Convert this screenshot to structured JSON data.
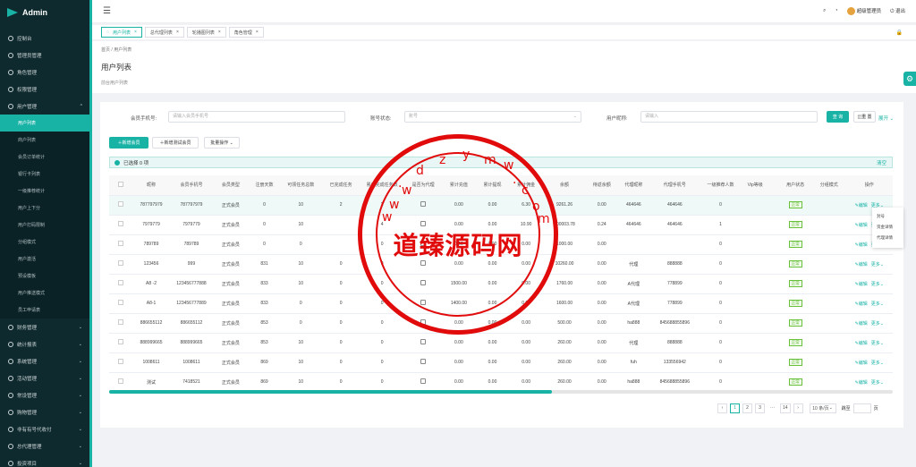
{
  "app": {
    "title": "Admin"
  },
  "sidebar": {
    "items": [
      {
        "label": "控制台"
      },
      {
        "label": "管理员管理"
      },
      {
        "label": "角色管理"
      },
      {
        "label": "权限管理"
      },
      {
        "label": "用户管理",
        "expanded": true
      }
    ],
    "subitems": [
      "用户列表",
      "商户列表",
      "会员订单统计",
      "银行卡列表",
      "一级推荐统计",
      "用户上下分",
      "用户打码限制",
      "分组模式",
      "用户激活",
      "预设模板",
      "用户推送模式",
      "员工申请表"
    ],
    "after": [
      "财务管理",
      "统计报表",
      "系统管理",
      "活动管理",
      "常设管理",
      "购物管理",
      "非有有号代收付",
      "总代理管理",
      "投资项目"
    ]
  },
  "topbar": {
    "admin": "超级管理员",
    "logout": "退出"
  },
  "tabs": [
    "用户列表",
    "总代理列表",
    "轮播图列表",
    "角色管理"
  ],
  "breadcrumb": {
    "home": "首页",
    "sep": "/",
    "current": "用户列表"
  },
  "page": {
    "title": "用户列表",
    "subtitle": "前台用户列表"
  },
  "search": {
    "phone_label": "会员手机号:",
    "phone_placeholder": "请输入会员手机号",
    "status_label": "账号状态:",
    "status_placeholder": "账号",
    "nick_label": "用户昵称:",
    "nick_placeholder": "请输入",
    "search_btn": "查 询",
    "reset_btn": "重 置",
    "expand": "展开"
  },
  "actions": {
    "add": "新增会员",
    "add_test": "新增测试会员",
    "batch": "批量操作"
  },
  "alert": {
    "text": "已选择 0 项",
    "clear": "清空"
  },
  "table": {
    "columns": [
      "",
      "昵称",
      "会员手机号",
      "会员类型",
      "注册天数",
      "可领任务总数",
      "已完成任务",
      "累计完成任务数",
      "是否为代理",
      "累计充值",
      "累计提现",
      "累计佣金",
      "余额",
      "待返余额",
      "代理昵称",
      "代理手机号",
      "一级推荐人数",
      "Vip等级",
      "",
      "用户状态",
      "分组模式",
      "操作"
    ],
    "rows": [
      [
        "",
        "787797979",
        "787797979",
        "正式会员",
        "0",
        "10",
        "2",
        "2",
        "",
        "0.00",
        "0.00",
        "6.30",
        "9261.26",
        "0.00",
        "464646",
        "464646",
        "0",
        "",
        "",
        "正常",
        "",
        "编辑",
        "更多"
      ],
      [
        "",
        "7979779",
        "7979779",
        "正式会员",
        "0",
        "10",
        "",
        "4",
        "",
        "0.00",
        "0.00",
        "10.90",
        "100003.78",
        "0.24",
        "464646",
        "464646",
        "1",
        "",
        "",
        "正常",
        "",
        "编辑",
        "更多"
      ],
      [
        "",
        "789789",
        "789789",
        "正式会员",
        "0",
        "0",
        "",
        "0",
        "",
        "0.00",
        "0.00",
        "0.00",
        "1000.00",
        "0.00",
        "",
        "",
        "0",
        "",
        "",
        "正常",
        "",
        "编辑",
        "更多"
      ],
      [
        "",
        "123456",
        "999",
        "正式会员",
        "831",
        "10",
        "0",
        "0",
        "",
        "0.00",
        "0.00",
        "0.00",
        "10260.00",
        "0.00",
        "代理",
        "888888",
        "0",
        "",
        "",
        "正常",
        "",
        "编辑",
        "更多"
      ],
      [
        "",
        "A8 -2",
        "123456777888",
        "正式会员",
        "833",
        "10",
        "0",
        "0",
        "",
        "1500.00",
        "0.00",
        "0.00",
        "1760.00",
        "0.00",
        "A代理",
        "778899",
        "0",
        "",
        "",
        "正常",
        "",
        "编辑",
        "更多"
      ],
      [
        "",
        "A8-1",
        "123456777889",
        "正式会员",
        "833",
        "0",
        "0",
        "0",
        "",
        "1400.00",
        "0.00",
        "0.00",
        "1600.00",
        "0.00",
        "A代理",
        "778899",
        "0",
        "",
        "",
        "正常",
        "",
        "编辑",
        "更多"
      ],
      [
        "",
        "886655112",
        "886655112",
        "正式会员",
        "853",
        "0",
        "0",
        "0",
        "",
        "0.00",
        "0.00",
        "0.00",
        "500.00",
        "0.00",
        "ha888",
        "845688855896",
        "0",
        "",
        "",
        "正常",
        "",
        "编辑",
        "更多"
      ],
      [
        "",
        "888999665",
        "888999665",
        "正式会员",
        "853",
        "10",
        "0",
        "0",
        "",
        "0.00",
        "0.00",
        "0.00",
        "260.00",
        "0.00",
        "代理",
        "888888",
        "0",
        "",
        "",
        "正常",
        "",
        "编辑",
        "更多"
      ],
      [
        "",
        "1008611",
        "1008611",
        "正式会员",
        "869",
        "10",
        "0",
        "0",
        "",
        "0.00",
        "0.00",
        "0.00",
        "260.00",
        "0.00",
        "fuh",
        "133556942",
        "0",
        "",
        "",
        "正常",
        "",
        "编辑",
        "更多"
      ],
      [
        "",
        "测试",
        "7418521",
        "正式会员",
        "869",
        "10",
        "0",
        "0",
        "",
        "0.00",
        "0.00",
        "0.00",
        "260.00",
        "0.00",
        "ha888",
        "845688855896",
        "0",
        "",
        "",
        "正常",
        "",
        "编辑",
        "更多"
      ]
    ]
  },
  "dropdown": [
    "封号",
    "资金详情",
    "代理详情"
  ],
  "pagination": {
    "pages": [
      "1",
      "2",
      "3",
      "···",
      "14"
    ],
    "page_size": "10 条/页",
    "goto": "跳至",
    "page_unit": "页"
  },
  "watermark": {
    "text": "道臻源码网",
    "url_chars": [
      "d",
      "z",
      "y",
      "m",
      "w",
      ".",
      "c",
      "o",
      "m",
      "w",
      "w",
      "w",
      "."
    ]
  },
  "colors": {
    "primary": "#19b3a6",
    "sidebar": "#0f2a2e",
    "watermark": "#e10b0b"
  }
}
